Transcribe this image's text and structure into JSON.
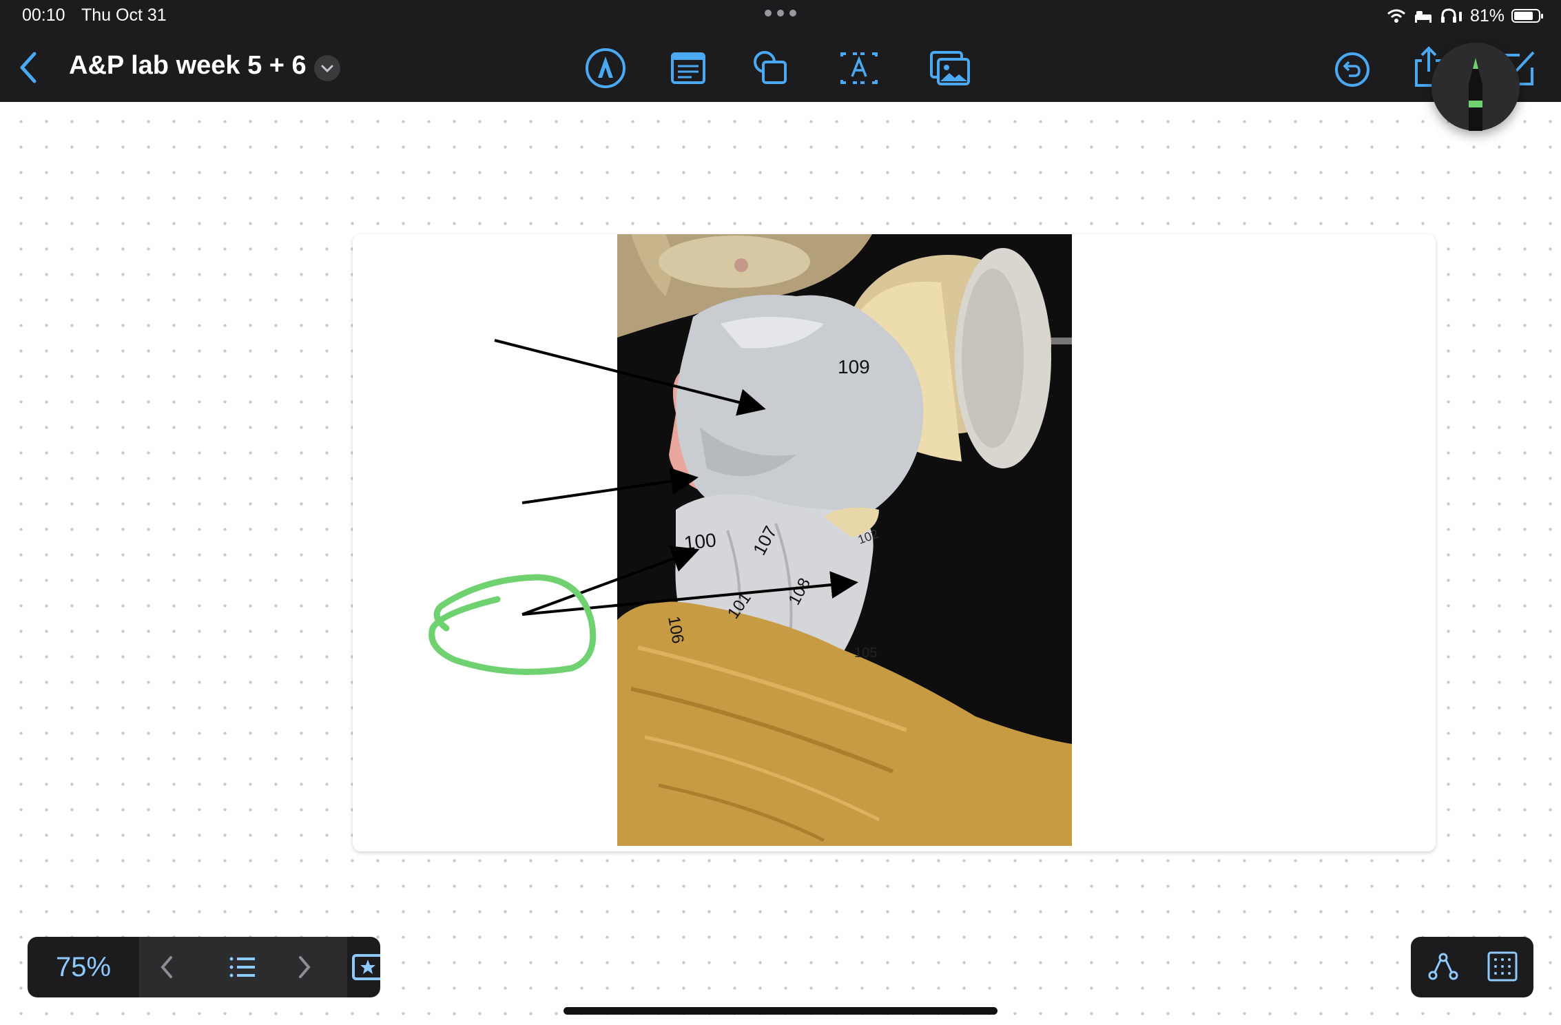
{
  "status_bar": {
    "time": "00:10",
    "date": "Thu Oct 31",
    "battery_percent": "81%",
    "battery_level": 0.81
  },
  "header": {
    "title": "A&P lab week 5 + 6",
    "tools": [
      "pen-tool-icon",
      "text-box-icon",
      "shapes-icon",
      "text-recognition-icon",
      "image-icon"
    ]
  },
  "photo": {
    "labels": [
      "109",
      "100",
      "107",
      "108",
      "106",
      "101",
      "105",
      "102"
    ]
  },
  "bottom_toolbar": {
    "zoom": "75%"
  },
  "colors": {
    "accent": "#4ba9f2",
    "highlight_green": "#6fd16f",
    "toolbar_bg": "#1c1c1e"
  }
}
